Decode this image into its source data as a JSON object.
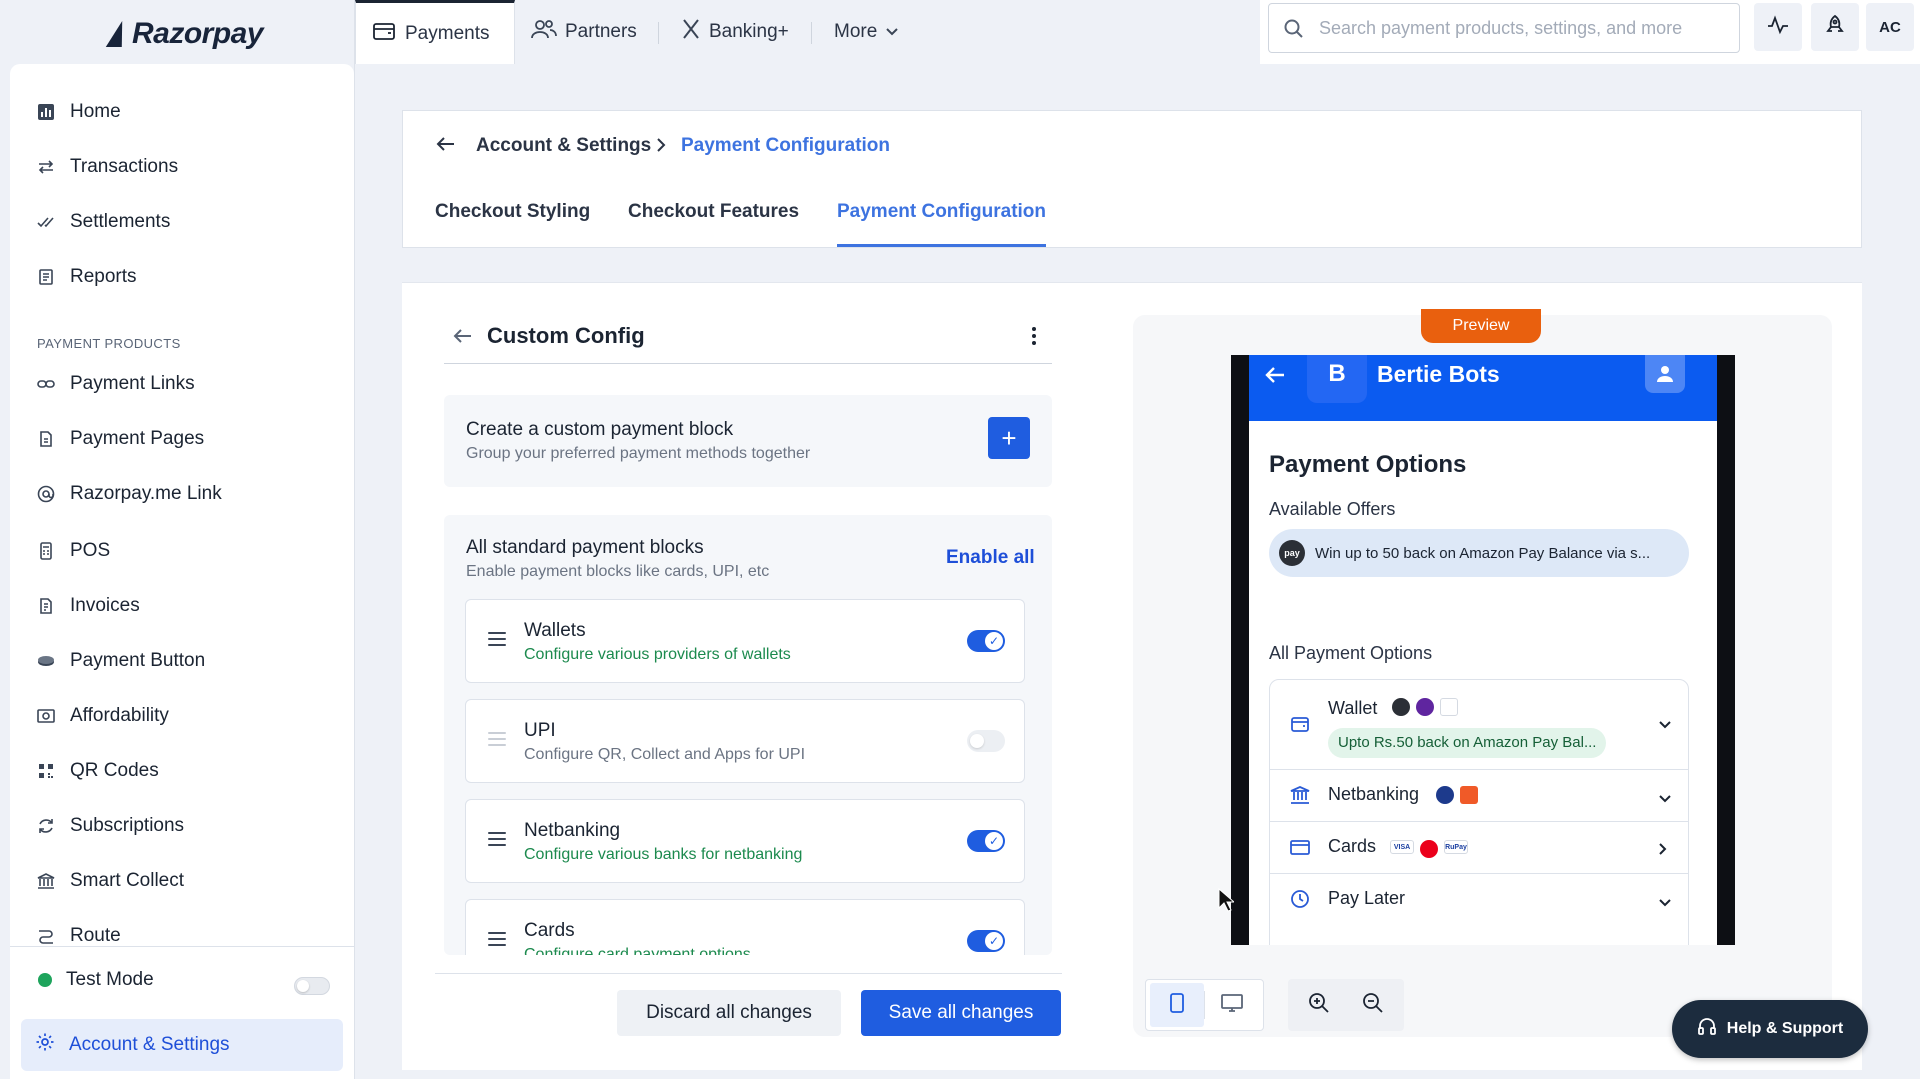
{
  "brand": {
    "name": "Razorpay"
  },
  "top_tabs": [
    {
      "label": "Payments",
      "icon": "payments-icon",
      "active": true
    },
    {
      "label": "Partners",
      "icon": "partners-icon"
    },
    {
      "label": "Banking+",
      "icon": "banking-x-icon"
    },
    {
      "label": "More",
      "icon": "chevron-down-icon"
    }
  ],
  "search": {
    "placeholder": "Search payment products, settings, and more",
    "value": ""
  },
  "top_actions": {
    "avatar_initials": "AC"
  },
  "sidebar": {
    "items": [
      {
        "label": "Home",
        "icon": "bar-chart-icon"
      },
      {
        "label": "Transactions",
        "icon": "transfer-arrows-icon"
      },
      {
        "label": "Settlements",
        "icon": "double-check-icon"
      },
      {
        "label": "Reports",
        "icon": "reports-icon"
      }
    ],
    "section_label": "PAYMENT PRODUCTS",
    "products": [
      {
        "label": "Payment Links",
        "icon": "link-icon"
      },
      {
        "label": "Payment Pages",
        "icon": "page-icon"
      },
      {
        "label": "Razorpay.me Link",
        "icon": "at-sign-icon"
      },
      {
        "label": "POS",
        "icon": "pos-terminal-icon"
      },
      {
        "label": "Invoices",
        "icon": "invoice-icon"
      },
      {
        "label": "Payment Button",
        "icon": "button-icon"
      },
      {
        "label": "Affordability",
        "icon": "cash-icon"
      },
      {
        "label": "QR Codes",
        "icon": "qr-code-icon"
      },
      {
        "label": "Subscriptions",
        "icon": "refresh-icon"
      },
      {
        "label": "Smart Collect",
        "icon": "bank-icon"
      },
      {
        "label": "Route",
        "icon": "route-icon"
      }
    ],
    "test_mode": {
      "label": "Test Mode",
      "enabled": false
    },
    "account_settings": {
      "label": "Account & Settings"
    }
  },
  "breadcrumb": {
    "parent": "Account & Settings",
    "current": "Payment Configuration"
  },
  "sub_tabs": [
    {
      "label": "Checkout Styling"
    },
    {
      "label": "Checkout Features"
    },
    {
      "label": "Payment Configuration",
      "active": true
    }
  ],
  "config": {
    "title": "Custom Config",
    "create_block": {
      "title": "Create a custom payment block",
      "subtitle": "Group your preferred payment methods together"
    },
    "standard": {
      "title": "All standard payment blocks",
      "subtitle": "Enable payment blocks like cards, UPI, etc",
      "enable_all": "Enable all",
      "methods": [
        {
          "name": "Wallets",
          "desc": "Configure various providers of wallets",
          "enabled": true
        },
        {
          "name": "UPI",
          "desc": "Configure QR, Collect and Apps for UPI",
          "enabled": false
        },
        {
          "name": "Netbanking",
          "desc": "Configure various banks for netbanking",
          "enabled": true
        },
        {
          "name": "Cards",
          "desc": "Configure card payment options",
          "enabled": true
        }
      ]
    },
    "discard_label": "Discard all changes",
    "save_label": "Save all changes"
  },
  "preview": {
    "label": "Preview",
    "merchant_initial": "B",
    "merchant_name": "Bertie Bots",
    "title": "Payment Options",
    "offers_heading": "Available Offers",
    "offer_text": "Win up to 50 back on Amazon Pay Balance via s...",
    "offer_badge": "pay",
    "all_heading": "All Payment Options",
    "options": [
      {
        "name": "Wallet",
        "offer": "Upto Rs.50 back on Amazon Pay Bal...",
        "icon": "wallet-icon"
      },
      {
        "name": "Netbanking",
        "icon": "bank-icon"
      },
      {
        "name": "Cards",
        "icon": "card-icon"
      },
      {
        "name": "Pay Later",
        "icon": "clock-icon"
      }
    ],
    "card_logos": [
      "VISA",
      "",
      "RuPay"
    ]
  },
  "help": {
    "label": "Help & Support"
  },
  "colors": {
    "primary": "#1f5de0",
    "accent_link": "#3d73e0",
    "success": "#1c8a4e",
    "preview_badge": "#e9600e",
    "phone_header": "#0b5bf0"
  }
}
